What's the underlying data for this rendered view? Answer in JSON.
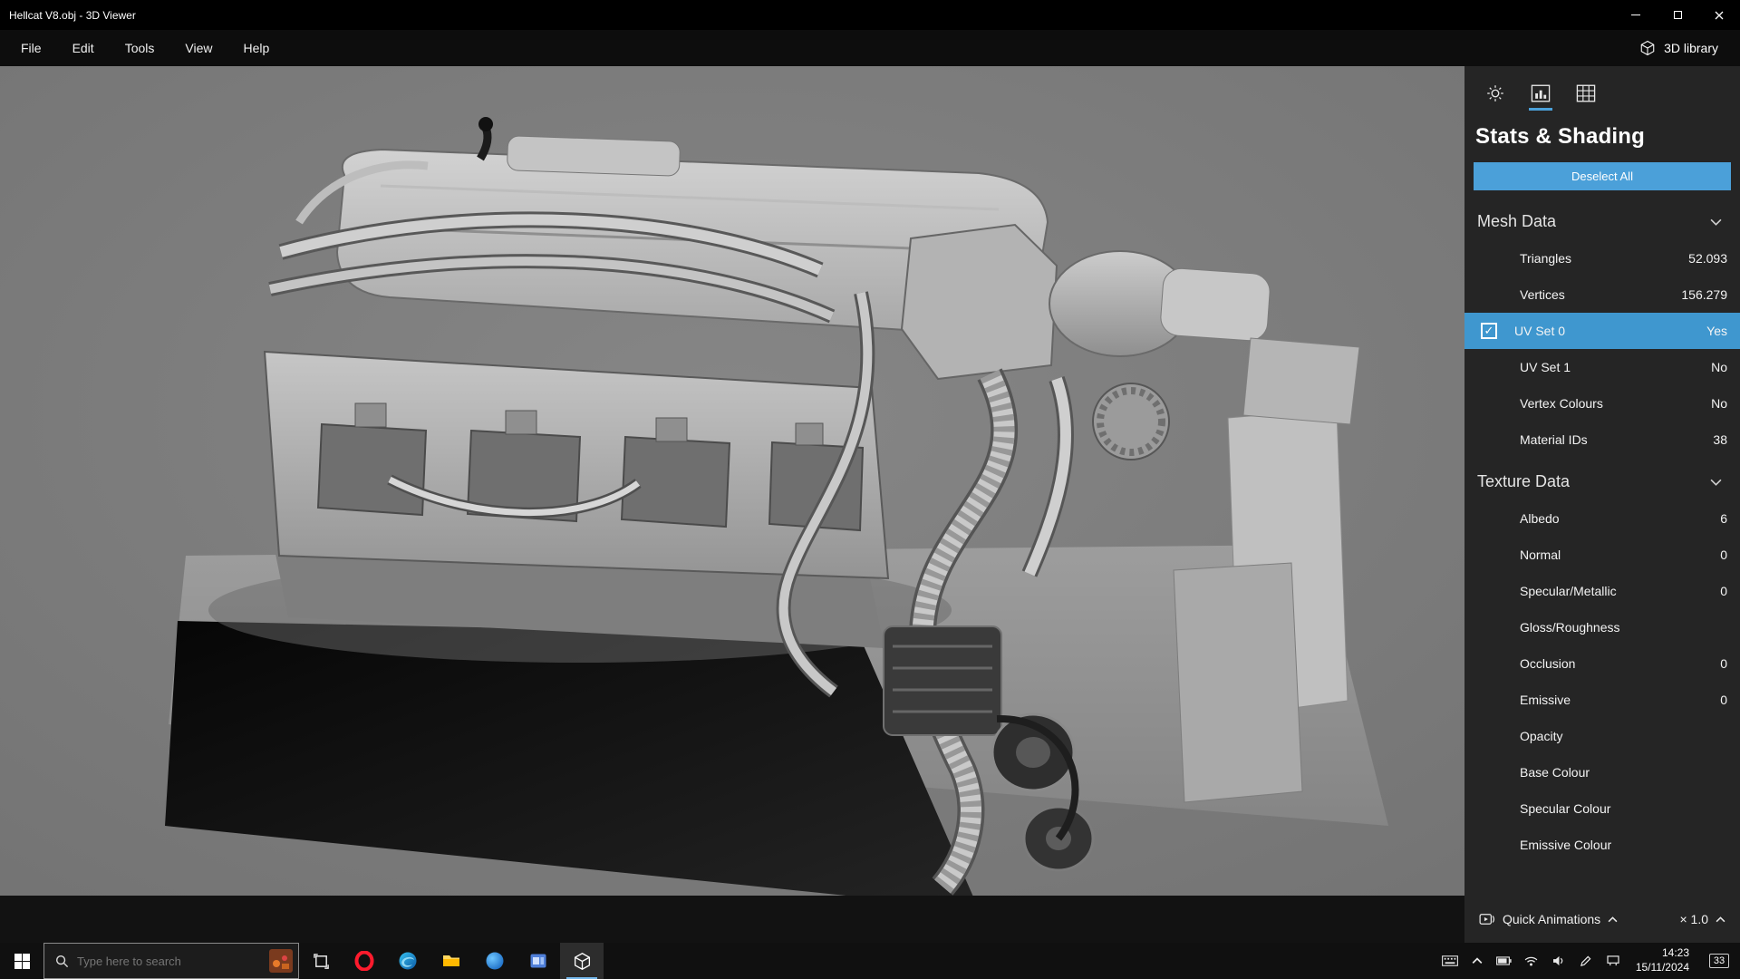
{
  "window": {
    "title": "Hellcat V8.obj - 3D Viewer"
  },
  "menu": {
    "items": [
      "File",
      "Edit",
      "Tools",
      "View",
      "Help"
    ],
    "library": "3D library"
  },
  "panel": {
    "tabs": [
      "environment",
      "stats-shading",
      "grid-view"
    ],
    "title": "Stats & Shading",
    "deselect_all": "Deselect All",
    "sections": [
      {
        "title": "Mesh Data",
        "rows": [
          {
            "label": "Triangles",
            "value": "52.093"
          },
          {
            "label": "Vertices",
            "value": "156.279"
          },
          {
            "label": "UV Set 0",
            "value": "Yes",
            "selected": true,
            "checked": true
          },
          {
            "label": "UV Set 1",
            "value": "No"
          },
          {
            "label": "Vertex Colours",
            "value": "No"
          },
          {
            "label": "Material IDs",
            "value": "38"
          }
        ]
      },
      {
        "title": "Texture Data",
        "rows": [
          {
            "label": "Albedo",
            "value": "6"
          },
          {
            "label": "Normal",
            "value": "0"
          },
          {
            "label": "Specular/Metallic",
            "value": "0"
          },
          {
            "label": "Gloss/Roughness",
            "value": ""
          },
          {
            "label": "Occlusion",
            "value": "0"
          },
          {
            "label": "Emissive",
            "value": "0"
          },
          {
            "label": "Opacity",
            "value": ""
          },
          {
            "label": "Base Colour",
            "value": ""
          },
          {
            "label": "Specular Colour",
            "value": ""
          },
          {
            "label": "Emissive Colour",
            "value": ""
          }
        ]
      }
    ],
    "footer": {
      "animations_label": "Quick Animations",
      "speed_label": "× 1.0"
    }
  },
  "taskbar": {
    "search_placeholder": "Type here to search",
    "app_icons": [
      "task-view",
      "opera",
      "edge",
      "file-explorer",
      "blue-app",
      "window-app",
      "3d-viewer"
    ],
    "tray_icons": [
      "touch-keyboard",
      "chevron-up",
      "battery",
      "wifi",
      "volume",
      "pen",
      "ethernet"
    ],
    "clock": {
      "time": "14:23",
      "date": "15/11/2024"
    },
    "notification_count": "33"
  },
  "colors": {
    "accent": "#4ba0d9",
    "selected_row": "#3f97cf",
    "panel": "#252525",
    "viewport": "#7c7c7c",
    "taskbar": "#101010"
  }
}
